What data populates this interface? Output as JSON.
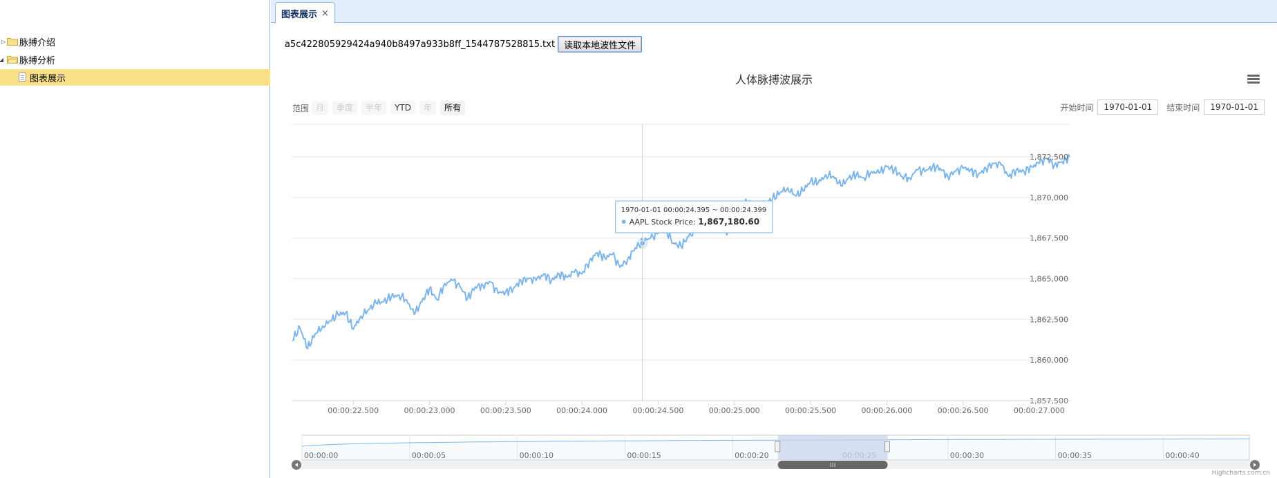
{
  "tree": {
    "items": [
      {
        "label": "脉搏介绍",
        "level": 0,
        "expanded": false
      },
      {
        "label": "脉搏分析",
        "level": 0,
        "expanded": true
      },
      {
        "label": "图表展示",
        "level": 1,
        "selected": true
      }
    ]
  },
  "tab": {
    "label": "图表展示",
    "close": "×"
  },
  "file": {
    "name": "a5c422805929424a940b8497a933b8ff_1544787528815.txt",
    "button": "读取本地波性文件"
  },
  "menu_icon": "hamburger-menu-icon",
  "range": {
    "label": "范围",
    "buttons": [
      {
        "label": "月",
        "state": "disabled"
      },
      {
        "label": "季度",
        "state": "disabled"
      },
      {
        "label": "半年",
        "state": "disabled"
      },
      {
        "label": "YTD",
        "state": "enabled"
      },
      {
        "label": "年",
        "state": "disabled"
      },
      {
        "label": "所有",
        "state": "selected"
      }
    ]
  },
  "dates": {
    "start_label": "开始时间",
    "start_value": "1970-01-01",
    "end_label": "结束时间",
    "end_value": "1970-01-01"
  },
  "tooltip": {
    "header": "1970-01-01 00:00:24.395 ~ 00:00:24.399",
    "series": "AAPL Stock Price",
    "value": "1,867,180.60"
  },
  "credits": "Highcharts.com.cn",
  "colors": {
    "series": "#7cb5ec",
    "navigator_fill": "#c8d6ee",
    "tab_border": "#95b8e7",
    "tree_selected": "#fbe08a"
  },
  "chart_data": {
    "type": "line",
    "title": "人体脉搏波展示",
    "series": [
      {
        "name": "AAPL Stock Price",
        "x": [
          22.1,
          22.15,
          22.2,
          22.25,
          22.3,
          22.35,
          22.4,
          22.45,
          22.5,
          22.55,
          22.6,
          22.65,
          22.7,
          22.75,
          22.8,
          22.85,
          22.9,
          22.95,
          23.0,
          23.05,
          23.1,
          23.15,
          23.2,
          23.25,
          23.3,
          23.35,
          23.4,
          23.45,
          23.5,
          23.55,
          23.6,
          23.65,
          23.7,
          23.75,
          23.8,
          23.85,
          23.9,
          23.95,
          24.0,
          24.05,
          24.1,
          24.15,
          24.2,
          24.25,
          24.3,
          24.35,
          24.4,
          24.45,
          24.5,
          24.55,
          24.6,
          24.65,
          24.7,
          24.75,
          24.8,
          24.85,
          24.9,
          24.95,
          25.0,
          25.05,
          25.1,
          25.15,
          25.2,
          25.25,
          25.3,
          25.35,
          25.4,
          25.45,
          25.5,
          25.55,
          25.6,
          25.65,
          25.7,
          25.75,
          25.8,
          25.85,
          25.9,
          25.95,
          26.0,
          26.05,
          26.1,
          26.15,
          26.2,
          26.25,
          26.3,
          26.35,
          26.4,
          26.45,
          26.5,
          26.55,
          26.6,
          26.65,
          26.7,
          26.75,
          26.8,
          26.85,
          26.9,
          26.95,
          27.0,
          27.05,
          27.1,
          27.15,
          27.2
        ],
        "values": [
          1861200,
          1862000,
          1860700,
          1861600,
          1862100,
          1862400,
          1862800,
          1862900,
          1861900,
          1862700,
          1863100,
          1863500,
          1863600,
          1863900,
          1864000,
          1863700,
          1862800,
          1863600,
          1864400,
          1863700,
          1864700,
          1864900,
          1864500,
          1863800,
          1864500,
          1864600,
          1864800,
          1864100,
          1864200,
          1864400,
          1864900,
          1865000,
          1864900,
          1865300,
          1864900,
          1865300,
          1865100,
          1865400,
          1865300,
          1866100,
          1866600,
          1866300,
          1866500,
          1865700,
          1866200,
          1866900,
          1867300,
          1867500,
          1867800,
          1868000,
          1867200,
          1867000,
          1867600,
          1868000,
          1868500,
          1868300,
          1868700,
          1867700,
          1868900,
          1869500,
          1869800,
          1869200,
          1869600,
          1869900,
          1870300,
          1870600,
          1870100,
          1870400,
          1871000,
          1870900,
          1871400,
          1871300,
          1870700,
          1871200,
          1871400,
          1871200,
          1871600,
          1871500,
          1871900,
          1871700,
          1871300,
          1871200,
          1871700,
          1871600,
          1871900,
          1871800,
          1871300,
          1871600,
          1871800,
          1871700,
          1871400,
          1871800,
          1872100,
          1872000,
          1871300,
          1871700,
          1871600,
          1871900,
          1872100,
          1872400,
          1872000,
          1872200,
          1872500
        ]
      }
    ],
    "xlim": [
      22.1,
      27.2
    ],
    "ylim": [
      1857500,
      1874500
    ],
    "x_ticks": [
      "00:00:22.500",
      "00:00:23.000",
      "00:00:23.500",
      "00:00:24.000",
      "00:00:24.500",
      "00:00:25.000",
      "00:00:25.500",
      "00:00:26.000",
      "00:00:26.500",
      "00:00:27.000"
    ],
    "x_tick_values": [
      22.5,
      23.0,
      23.5,
      24.0,
      24.5,
      25.0,
      25.5,
      26.0,
      26.5,
      27.0
    ],
    "y_ticks": [
      "1,857,500",
      "1,860,000",
      "1,862,500",
      "1,865,000",
      "1,867,500",
      "1,870,000",
      "1,872,500"
    ],
    "y_tick_values": [
      1857500,
      1860000,
      1862500,
      1865000,
      1867500,
      1870000,
      1872500
    ],
    "grid": true,
    "crosshair_x": 24.397,
    "hover_point": {
      "x": 24.397,
      "y": 1867180.6
    },
    "navigator": {
      "x_ticks": [
        "00:00:00",
        "00:00:05",
        "00:00:10",
        "00:00:15",
        "00:00:20",
        "00:00:25",
        "00:00:30",
        "00:00:35",
        "00:00:40"
      ],
      "x_tick_values": [
        0,
        5,
        10,
        15,
        20,
        25,
        30,
        35,
        40
      ],
      "xlim": [
        0,
        44
      ],
      "selected_range": [
        22.1,
        27.2
      ]
    }
  }
}
